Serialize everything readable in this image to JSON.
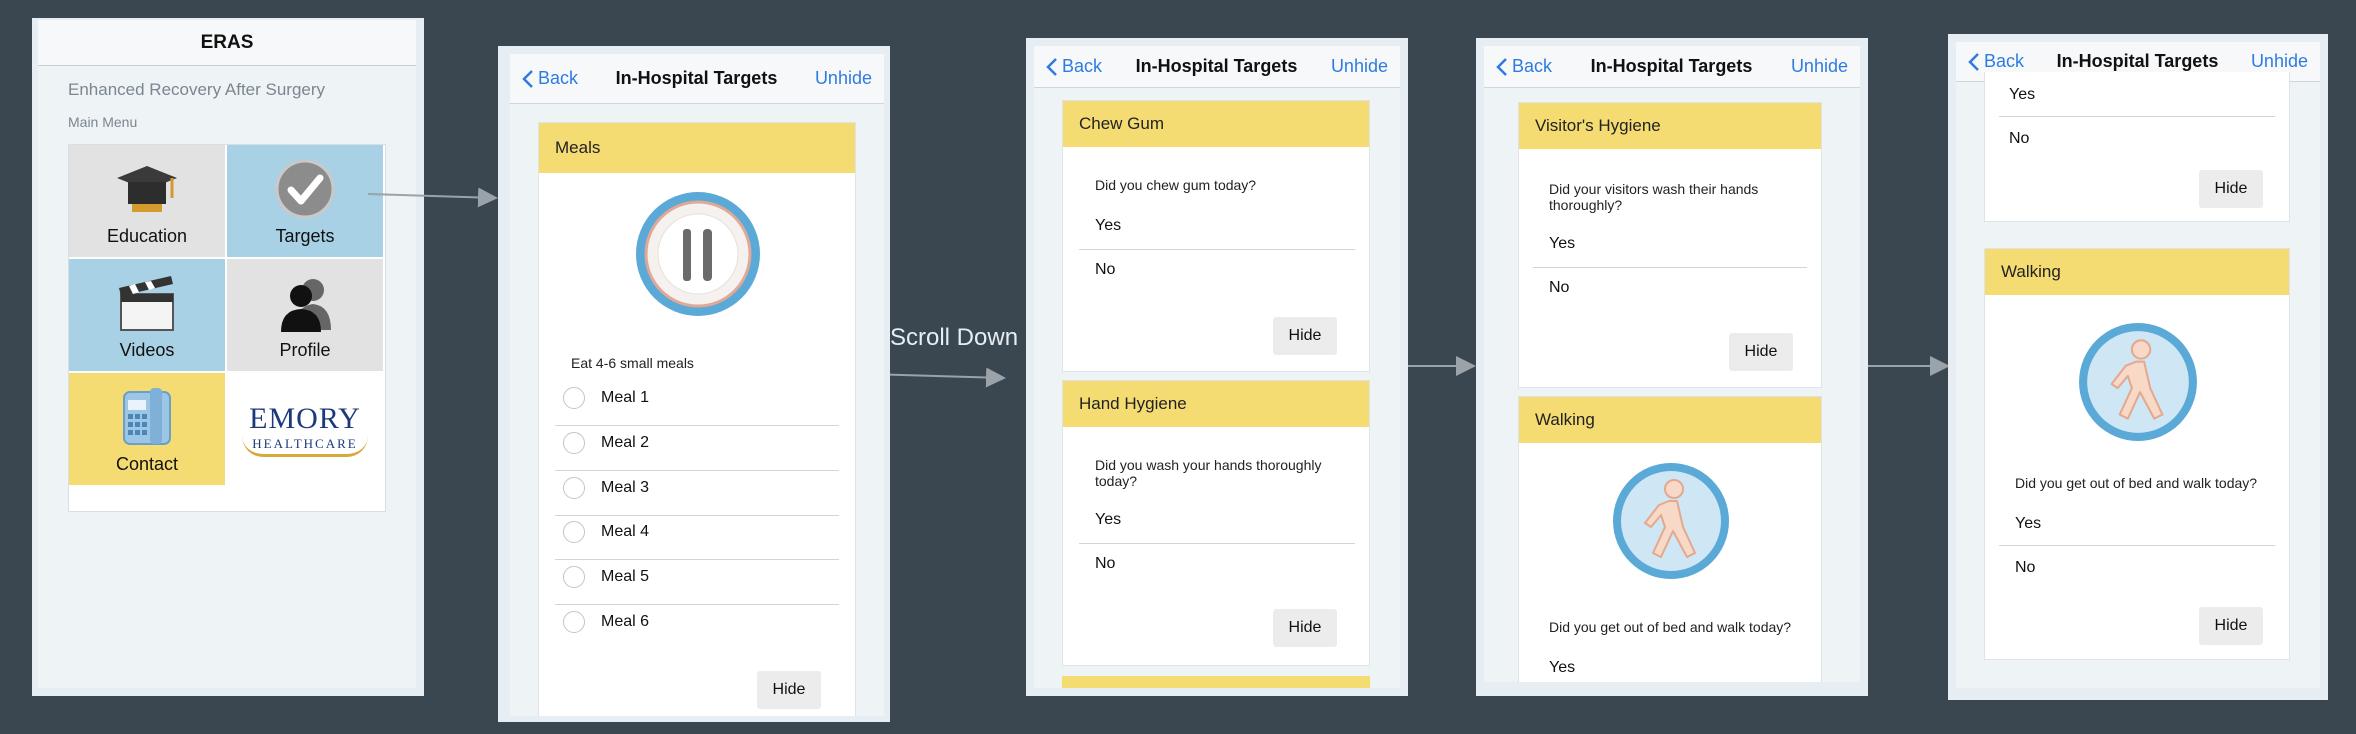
{
  "home": {
    "title": "ERAS",
    "subtitle": "Enhanced Recovery After Surgery",
    "section": "Main Menu",
    "tiles": {
      "education": "Education",
      "targets": "Targets",
      "videos": "Videos",
      "profile": "Profile",
      "contact": "Contact"
    },
    "logo": {
      "line1": "EMORY",
      "line2": "HEALTHCARE"
    }
  },
  "nav": {
    "back": "Back",
    "title": "In-Hospital Targets",
    "unhide": "Unhide"
  },
  "annotation": {
    "scroll_down": "Scroll Down"
  },
  "screen2": {
    "meals_header": "Meals",
    "meals_instruction": "Eat 4-6 small meals",
    "meals": [
      "Meal 1",
      "Meal 2",
      "Meal 3",
      "Meal 4",
      "Meal 5",
      "Meal 6"
    ],
    "hide": "Hide"
  },
  "screen3": {
    "chew_gum": {
      "header": "Chew Gum",
      "question": "Did you chew gum today?",
      "yes": "Yes",
      "no": "No",
      "hide": "Hide"
    },
    "hand_hygiene": {
      "header": "Hand Hygiene",
      "question_line1": "Did you wash your hands thoroughly",
      "question_line2": "today?",
      "yes": "Yes",
      "no": "No",
      "hide": "Hide"
    }
  },
  "screen4": {
    "visitor_hygiene": {
      "header": "Visitor's Hygiene",
      "question_line1": "Did your visitors wash their hands",
      "question_line2": "thoroughly?",
      "yes": "Yes",
      "no": "No",
      "hide": "Hide"
    },
    "walking": {
      "header": "Walking",
      "question": "Did you get out of bed and walk today?",
      "yes": "Yes"
    }
  },
  "screen5": {
    "prev": {
      "yes": "Yes",
      "no": "No",
      "hide": "Hide"
    },
    "walking": {
      "header": "Walking",
      "question": "Did you get out of bed and walk today?",
      "yes": "Yes",
      "no": "No",
      "hide": "Hide"
    }
  },
  "colors": {
    "accent": "#2f7be0",
    "card_header": "#f5dc72",
    "tile_blue": "#a9d1e6",
    "tile_gray": "#e2e2e2",
    "tile_yellow": "#f5dc72",
    "background": "#3a4650"
  }
}
